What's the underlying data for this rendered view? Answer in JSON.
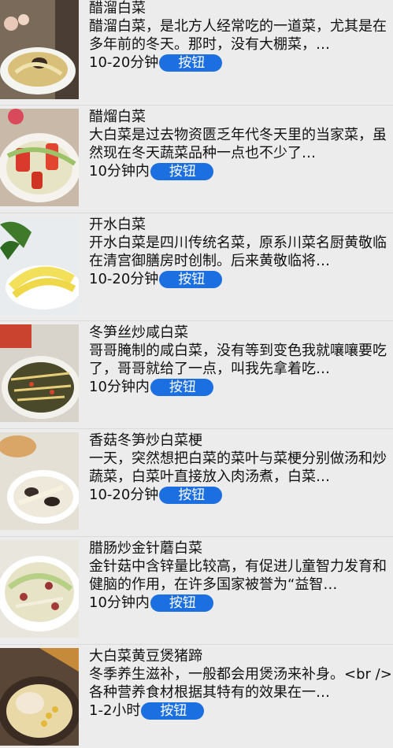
{
  "recipes": [
    {
      "title": "醋溜白菜",
      "desc": "醋溜白菜，是北方人经常吃的一道菜，尤其是在多年前的冬天。那时，没有大棚菜，…",
      "time": "10-20分钟",
      "button": "按钮",
      "image_icon": "dish-photo"
    },
    {
      "title": "醋熘白菜",
      "desc": "大白菜是过去物资匮乏年代冬天里的当家菜，虽然现在冬天蔬菜品种一点也不少了…",
      "time": "10分钟内",
      "button": "按钮",
      "image_icon": "dish-photo"
    },
    {
      "title": "开水白菜",
      "desc": "开水白菜是四川传统名菜，原系川菜名厨黄敬临在清宫御膳房时创制。后来黄敬临将…",
      "time": "10-20分钟",
      "button": "按钮",
      "image_icon": "dish-photo"
    },
    {
      "title": "冬笋丝炒咸白菜",
      "desc": "哥哥腌制的咸白菜，没有等到变色我就嚷嚷要吃了，哥哥就给了一点，叫我先拿着吃…",
      "time": "10分钟内",
      "button": "按钮",
      "image_icon": "dish-photo"
    },
    {
      "title": "香菇冬笋炒白菜梗",
      "desc": "一天，突然想把白菜的菜叶与菜梗分别做汤和炒蔬菜，白菜叶直接放入肉汤煮，白菜…",
      "time": "10-20分钟",
      "button": "按钮",
      "image_icon": "dish-photo"
    },
    {
      "title": "腊肠炒金针蘑白菜",
      "desc": "金针菇中含锌量比较高，有促进儿童智力发育和健脑的作用，在许多国家被誉为“益智…",
      "time": "10分钟内",
      "button": "按钮",
      "image_icon": "dish-photo"
    },
    {
      "title": "大白菜黄豆煲猪蹄",
      "desc": "冬季养生滋补，一般都会用煲汤来补身。<br />各种营养食材根据其特有的效果在一…",
      "time": "1-2小时",
      "button": "按钮",
      "image_icon": "dish-photo"
    }
  ],
  "colors": {
    "button_bg": "#1c6fe0",
    "page_bg": "#ececec"
  }
}
